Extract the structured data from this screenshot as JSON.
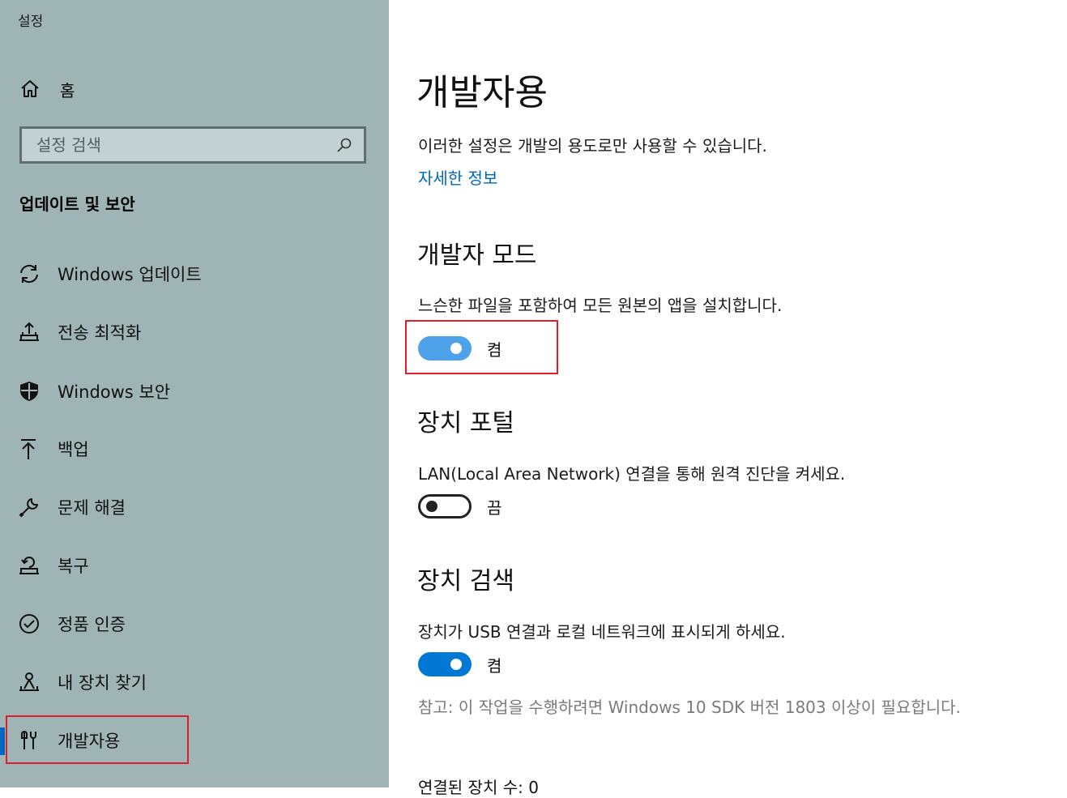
{
  "app": {
    "title": "설정"
  },
  "sidebar": {
    "home_label": "홈",
    "search_placeholder": "설정 검색",
    "section_title": "업데이트 및 보안",
    "items": [
      {
        "label": "Windows 업데이트",
        "icon": "refresh-icon"
      },
      {
        "label": "전송 최적화",
        "icon": "delivery-optimization-icon"
      },
      {
        "label": "Windows 보안",
        "icon": "shield-icon"
      },
      {
        "label": "백업",
        "icon": "upload-arrow-icon"
      },
      {
        "label": "문제 해결",
        "icon": "wrench-icon"
      },
      {
        "label": "복구",
        "icon": "recovery-icon"
      },
      {
        "label": "정품 인증",
        "icon": "check-circle-icon"
      },
      {
        "label": "내 장치 찾기",
        "icon": "find-device-icon"
      },
      {
        "label": "개발자용",
        "icon": "developer-tools-icon",
        "active": true
      }
    ]
  },
  "main": {
    "title": "개발자용",
    "intro": "이러한 설정은 개발의 용도로만 사용할 수 있습니다.",
    "more_info_link": "자세한 정보",
    "developer_mode": {
      "heading": "개발자 모드",
      "description": "느슨한 파일을 포함하여 모든 원본의 앱을 설치합니다.",
      "toggle_state": "켬"
    },
    "device_portal": {
      "heading": "장치 포털",
      "description": "LAN(Local Area Network) 연결을 통해 원격 진단을 켜세요.",
      "toggle_state": "끔"
    },
    "device_discovery": {
      "heading": "장치 검색",
      "description": "장치가 USB 연결과 로컬 네트워크에 표시되게 하세요.",
      "toggle_state": "켬",
      "note": "참고: 이 작업을 수행하려면 Windows 10 SDK 버전 1803 이상이 필요합니다.",
      "connected_count": "연결된 장치 수: 0"
    }
  },
  "colors": {
    "sidebar_bg": "#9fb4b4",
    "accent": "#0078d4",
    "link": "#0067c0",
    "highlight": "#e01e2a"
  }
}
